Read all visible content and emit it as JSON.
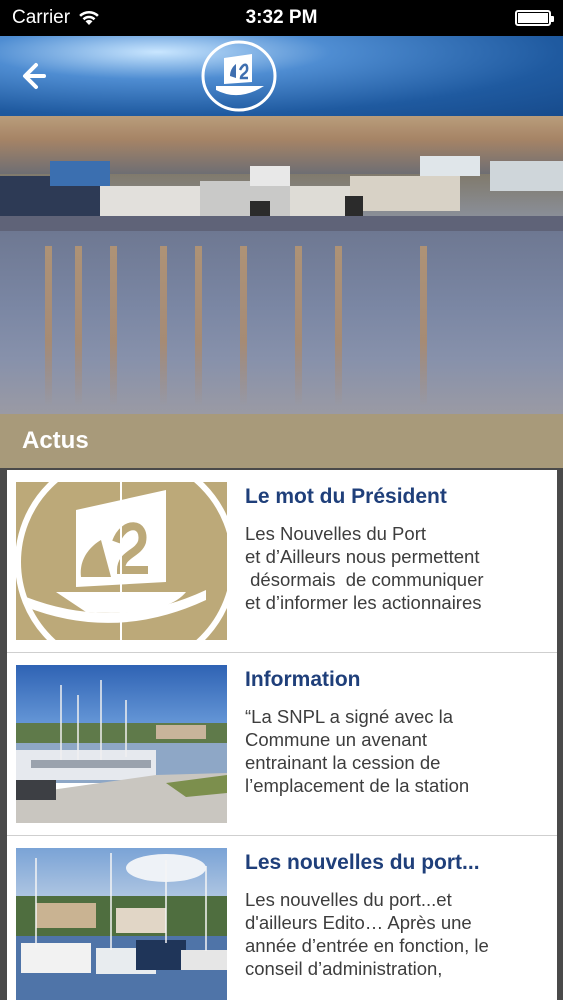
{
  "status_bar": {
    "carrier": "Carrier",
    "time": "3:32 PM"
  },
  "header": {
    "back_icon": "back-arrow-icon",
    "logo_icon": "boat-logo-icon"
  },
  "section": {
    "title": "Actus"
  },
  "articles": [
    {
      "title": "Le mot du Président",
      "text": "Les Nouvelles du Port\net d’Ailleurs nous permettent\n désormais  de communiquer\net d’informer les actionnaires",
      "thumb": "logo-image"
    },
    {
      "title": "Information",
      "text": "“La SNPL a signé avec la\nCommune un avenant\nentrainant la cession de\nl’emplacement de la station",
      "thumb": "marina-photo"
    },
    {
      "title": "Les nouvelles du port...",
      "text": "Les nouvelles du port...et\nd'ailleurs Edito… Après une\nannée d’entrée en fonction, le\nconseil d’administration,",
      "thumb": "harbor-photo"
    }
  ],
  "colors": {
    "section_bg": "#a89a7a",
    "title_blue": "#1f3f7a",
    "logo_tan": "#bca979"
  }
}
